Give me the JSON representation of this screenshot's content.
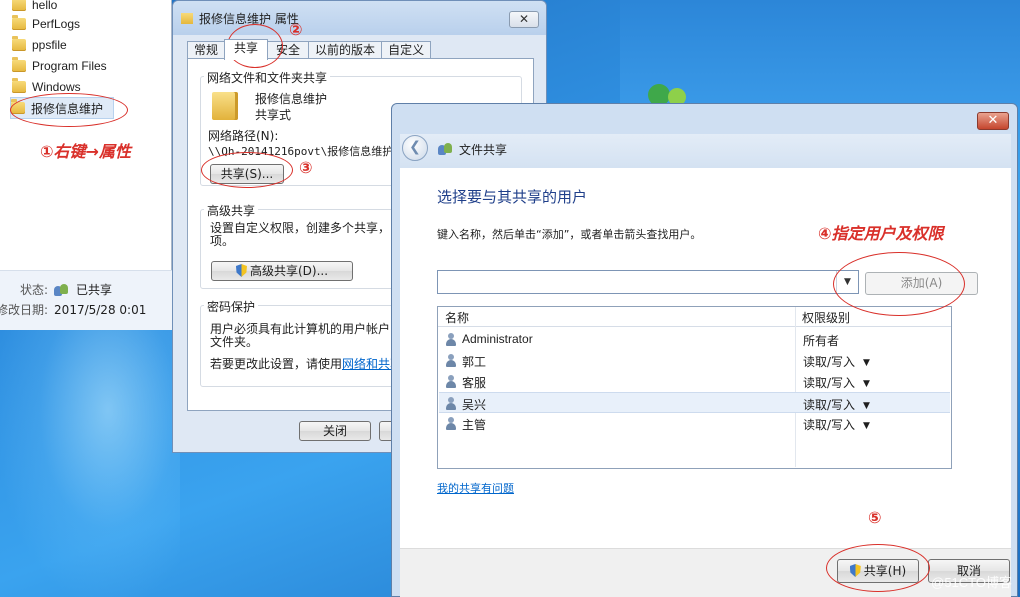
{
  "explorer": {
    "tree": [
      {
        "label": "hello"
      },
      {
        "label": "PerfLogs"
      },
      {
        "label": "ppsfile"
      },
      {
        "label": "Program Files"
      },
      {
        "label": "Windows"
      },
      {
        "label": "报修信息维护"
      }
    ],
    "details": {
      "status_key": "状态:",
      "status_value": "已共享",
      "date_key": "修改日期:",
      "date_value": "2017/5/28 0:01"
    }
  },
  "props_dialog": {
    "title": "报修信息维护 属性",
    "close_label": "✕",
    "tabs": [
      {
        "label": "常规"
      },
      {
        "label": "共享"
      },
      {
        "label": "安全"
      },
      {
        "label": "以前的版本"
      },
      {
        "label": "自定义"
      }
    ],
    "network_group": {
      "label": "网络文件和文件夹共享",
      "folder_name": "报修信息维护",
      "folder_state": "共享式",
      "path_label": "网络路径(N):",
      "path_value": "\\\\Qh-20141216povt\\报修信息维护",
      "share_button": "共享(S)..."
    },
    "advanced_group": {
      "label": "高级共享",
      "desc_line1": "设置自定义权限，创建多个共享，",
      "desc_line2": "项。",
      "button": "高级共享(D)..."
    },
    "password_group": {
      "label": "密码保护",
      "line1": "用户必须具有此计算机的用户帐户",
      "line2": "文件夹。",
      "line3_prefix": "若要更改此设置，请使用",
      "line3_link": "网络和共享"
    },
    "close_button": "关闭"
  },
  "share_dialog": {
    "title": "文件共享",
    "close_label": "✕",
    "back_icon": "back-arrow-icon",
    "heading": "选择要与其共享的用户",
    "instruction": "键入名称，然后单击“添加”，或者单击箭头查找用户。",
    "input_value": "",
    "add_button": "添加(A)",
    "columns": {
      "name": "名称",
      "permission": "权限级别"
    },
    "users": [
      {
        "name": "Administrator",
        "permission": "所有者",
        "has_dropdown": false
      },
      {
        "name": "郭工",
        "permission": "读取/写入",
        "has_dropdown": true
      },
      {
        "name": "客服",
        "permission": "读取/写入",
        "has_dropdown": true
      },
      {
        "name": "吴兴",
        "permission": "读取/写入",
        "has_dropdown": true,
        "selected": true
      },
      {
        "name": "主管",
        "permission": "读取/写入",
        "has_dropdown": true
      }
    ],
    "help_link": "我的共享有问题",
    "share_button": "共享(H)",
    "cancel_button": "取消"
  },
  "annotations": {
    "step1": "①右键→属性",
    "step2": "②",
    "step3": "③",
    "step4": "④指定用户及权限",
    "step5": "⑤"
  },
  "watermark": "@51CTO博客",
  "colors": {
    "annotation_red": "#d9302a",
    "heading_blue": "#1f3f8a",
    "link_blue": "#0066cc"
  }
}
